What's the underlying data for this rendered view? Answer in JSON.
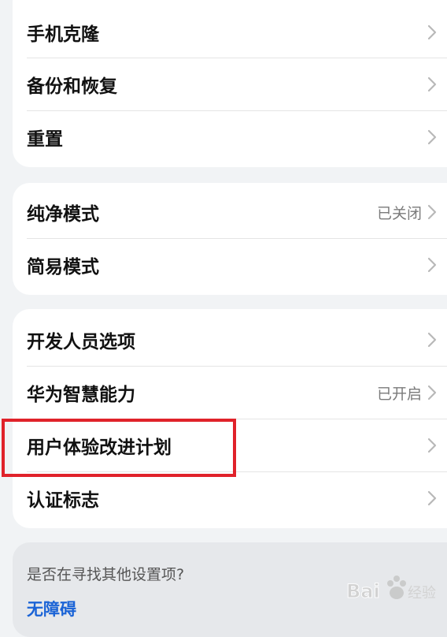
{
  "groups": [
    {
      "items": [
        {
          "label": "手机克隆",
          "value": ""
        },
        {
          "label": "备份和恢复",
          "value": ""
        },
        {
          "label": "重置",
          "value": ""
        }
      ]
    },
    {
      "items": [
        {
          "label": "纯净模式",
          "value": "已关闭"
        },
        {
          "label": "简易模式",
          "value": ""
        }
      ]
    },
    {
      "items": [
        {
          "label": "开发人员选项",
          "value": ""
        },
        {
          "label": "华为智慧能力",
          "value": "已开启"
        },
        {
          "label": "用户体验改进计划",
          "value": ""
        },
        {
          "label": "认证标志",
          "value": ""
        }
      ]
    }
  ],
  "footer": {
    "hint": "是否在寻找其他设置项?",
    "link": "无障碍"
  },
  "watermark": {
    "text": "Baidu经验"
  },
  "colors": {
    "highlight": "#e0222a",
    "link": "#1a63d6",
    "background": "#f1f3f5"
  },
  "highlighted_item": "用户体验改进计划"
}
